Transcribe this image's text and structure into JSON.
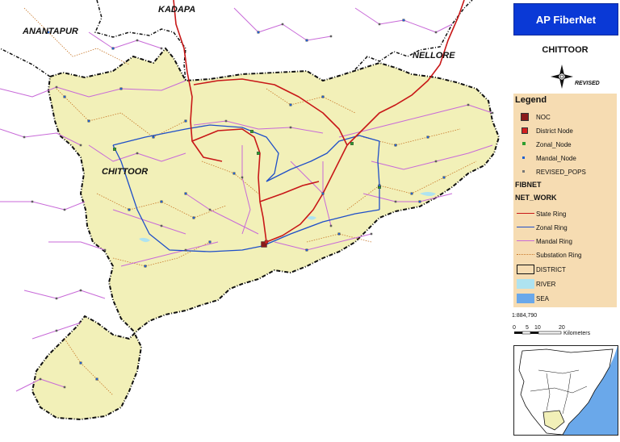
{
  "panel": {
    "banner": "AP FiberNet",
    "district_title": "CHITTOOR",
    "revised_label": "REVISED",
    "scale_text": "1:884,790",
    "scale_ticks": [
      "0",
      "5",
      "10",
      "20"
    ],
    "scale_unit": "Kilometers"
  },
  "legend": {
    "title": "Legend",
    "points": [
      {
        "label": "NOC",
        "icon": "noc-square",
        "color": "#8b1a1a"
      },
      {
        "label": "District Node",
        "icon": "district-node-square",
        "color": "#d42020"
      },
      {
        "label": "Zonal_Node",
        "icon": "zonal-node-square",
        "color": "#2e9e2e"
      },
      {
        "label": "Mandal_Node",
        "icon": "mandal-node-square",
        "color": "#2060d0"
      },
      {
        "label": "REVISED_POPS",
        "icon": "revised-pops-square",
        "color": "#777777"
      }
    ],
    "network_heading_1": "FIBNET",
    "network_heading_2": "NET_WORK",
    "lines": [
      {
        "label": "State Ring",
        "color": "#c81818",
        "style": "solid"
      },
      {
        "label": "Zonal Ring",
        "color": "#1f4fc8",
        "style": "solid"
      },
      {
        "label": "Mandal Ring",
        "color": "#c86ad8",
        "style": "solid"
      },
      {
        "label": "Substation Ring",
        "color": "#c8782a",
        "style": "dotted"
      }
    ],
    "areas": [
      {
        "label": "DISTRICT",
        "fill": "#f6dcb2",
        "stroke": "#111111"
      },
      {
        "label": "RIVER",
        "fill": "#aee3f0",
        "stroke": "#aee3f0"
      },
      {
        "label": "SEA",
        "fill": "#6aa8ea",
        "stroke": "#6aa8ea"
      }
    ]
  },
  "map": {
    "colors": {
      "district_fill": "#f2f0b8",
      "outside_fill": "#ffffff",
      "boundary": "#111111",
      "state_ring": "#c81818",
      "zonal_ring": "#1f4fc8",
      "mandal_ring": "#c86ad8",
      "substation_ring": "#c8782a",
      "river": "#aee3f0",
      "sea": "#6aa8ea"
    },
    "region_labels": [
      "ANANTAPUR",
      "KADAPA",
      "NELLORE",
      "CHITTOOR"
    ]
  }
}
